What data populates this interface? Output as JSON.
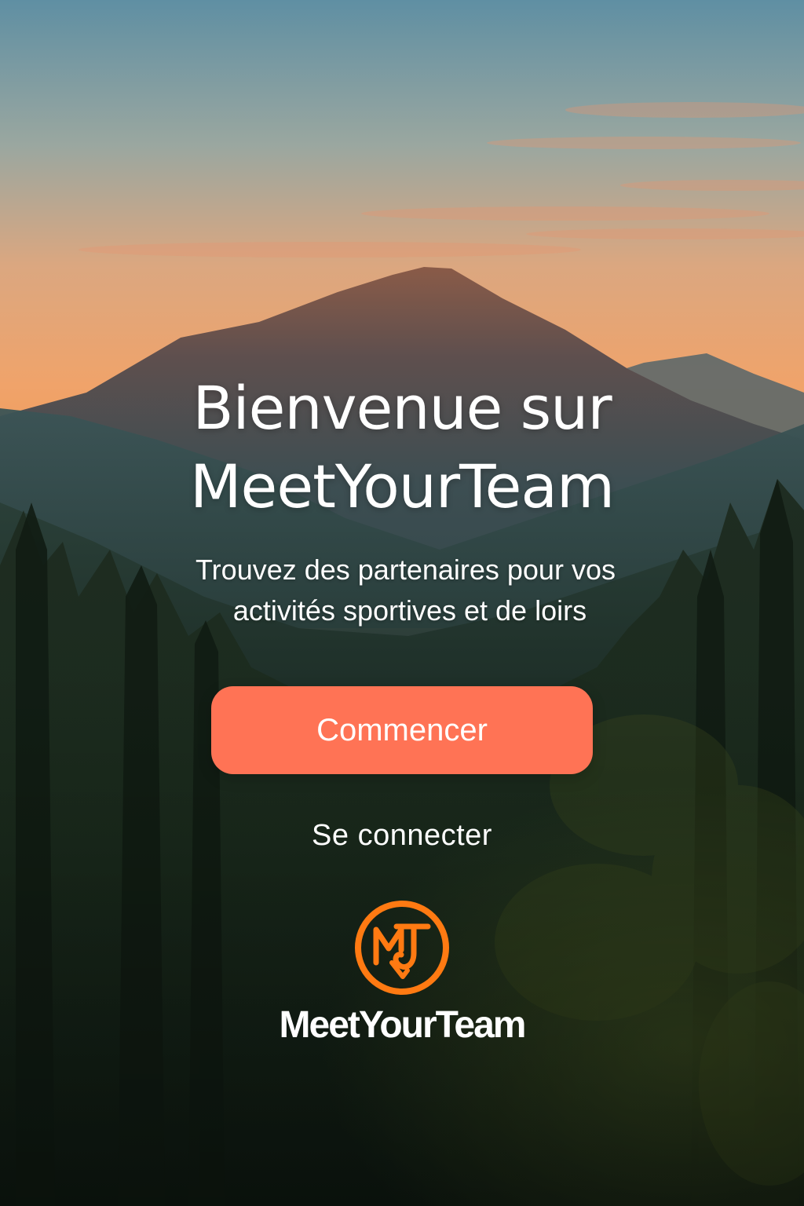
{
  "welcome": {
    "title_line1": "Bienvenue sur",
    "title_line2": "MeetYourTeam",
    "subtitle_line1": "Trouvez des partenaires pour vos",
    "subtitle_line2": "activités sportives et de loirs"
  },
  "actions": {
    "primary_label": "Commencer",
    "secondary_label": "Se connecter"
  },
  "brand": {
    "logo_icon": "mt-monogram-icon",
    "logo_letters": "MT",
    "name": "MeetYourTeam"
  },
  "colors": {
    "accent": "#ff7355",
    "logo": "#ff7a12",
    "text": "#ffffff"
  }
}
